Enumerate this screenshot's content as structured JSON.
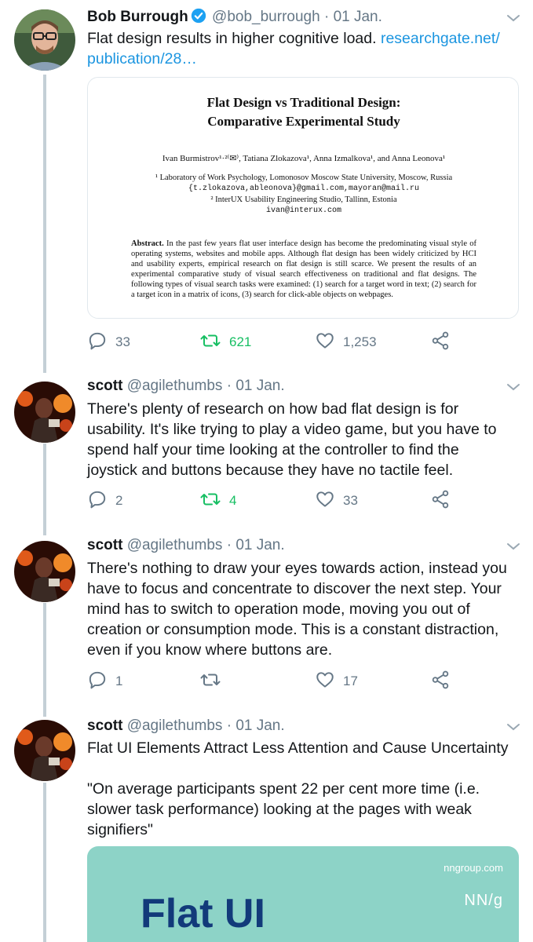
{
  "tweets": [
    {
      "name": "Bob Burrough",
      "verified": true,
      "handle": "@bob_burrough",
      "separator": "·",
      "date": "01 Jan.",
      "text": "Flat design results in higher cognitive load. ",
      "link": "researchgate.net/\npublication/28…",
      "replies": "33",
      "retweets": "621",
      "likes": "1,253",
      "retweeted": true
    },
    {
      "name": "scott",
      "handle": "@agilethumbs",
      "separator": "·",
      "date": "01 Jan.",
      "text": "There's plenty of research on how bad flat design is for usability. It's like trying to play a video game, but you have to spend half your time looking at the controller to find the joystick and buttons because they have no tactile feel.",
      "replies": "2",
      "retweets": "4",
      "likes": "33",
      "retweeted": true
    },
    {
      "name": "scott",
      "handle": "@agilethumbs",
      "separator": "·",
      "date": "01 Jan.",
      "text": "There's nothing to draw your eyes towards action, instead you have to focus and concentrate to discover the next step. Your mind has to switch to operation mode, moving you out of creation or consumption mode. This is a constant distraction, even if you know where buttons are.",
      "replies": "1",
      "retweets": "",
      "likes": "17",
      "retweeted": false
    },
    {
      "name": "scott",
      "handle": "@agilethumbs",
      "separator": "·",
      "date": "01 Jan.",
      "text": "Flat UI Elements Attract Less Attention and Cause Uncertainty\n\n\"On average participants spent 22 per cent more time (i.e. slower task performance) looking at the pages with weak signifiers\""
    }
  ],
  "paper": {
    "title_line1": "Flat Design vs Traditional Design:",
    "title_line2": "Comparative Experimental Study",
    "authors": "Ivan Burmistrov¹·²⁽✉⁾, Tatiana Zlokazova¹, Anna Izmalkova¹, and Anna Leonova¹",
    "affil1": "¹ Laboratory of Work Psychology, Lomonosov Moscow State University, Moscow, Russia",
    "affil1_email": "{t.zlokazova,ableonova}@gmail.com,mayoran@mail.ru",
    "affil2": "² InterUX Usability Engineering Studio, Tallinn, Estonia",
    "affil2_email": "ivan@interux.com",
    "abstract_label": "Abstract.",
    "abstract_text": " In the past few years flat user interface design has become the predominating visual style of operating systems, websites and mobile apps. Although flat design has been widely criticized by HCI and usability experts, empirical research on flat design is still scarce. We present the results of an experimental comparative study of visual search effectiveness on traditional and flat designs. The following types of visual search tasks were examined: (1) search for a target word in text; (2) search for a target icon in a matrix of icons, (3) search for click-able objects on webpages."
  },
  "link_card": {
    "site": "nngroup.com",
    "logo": "NN/g",
    "title": "Flat UI"
  },
  "colors": {
    "text": "#14171a",
    "muted": "#657786",
    "link": "#1b95e0",
    "retweet_active": "#17bf63",
    "verified": "#1da1f2",
    "thread_line": "#c4cfd6",
    "card_bg": "#8dd3c7",
    "card_title": "#123a7a"
  },
  "icons": [
    "verified-badge-icon",
    "chevron-down-icon",
    "reply-icon",
    "retweet-icon",
    "like-icon",
    "share-icon"
  ]
}
